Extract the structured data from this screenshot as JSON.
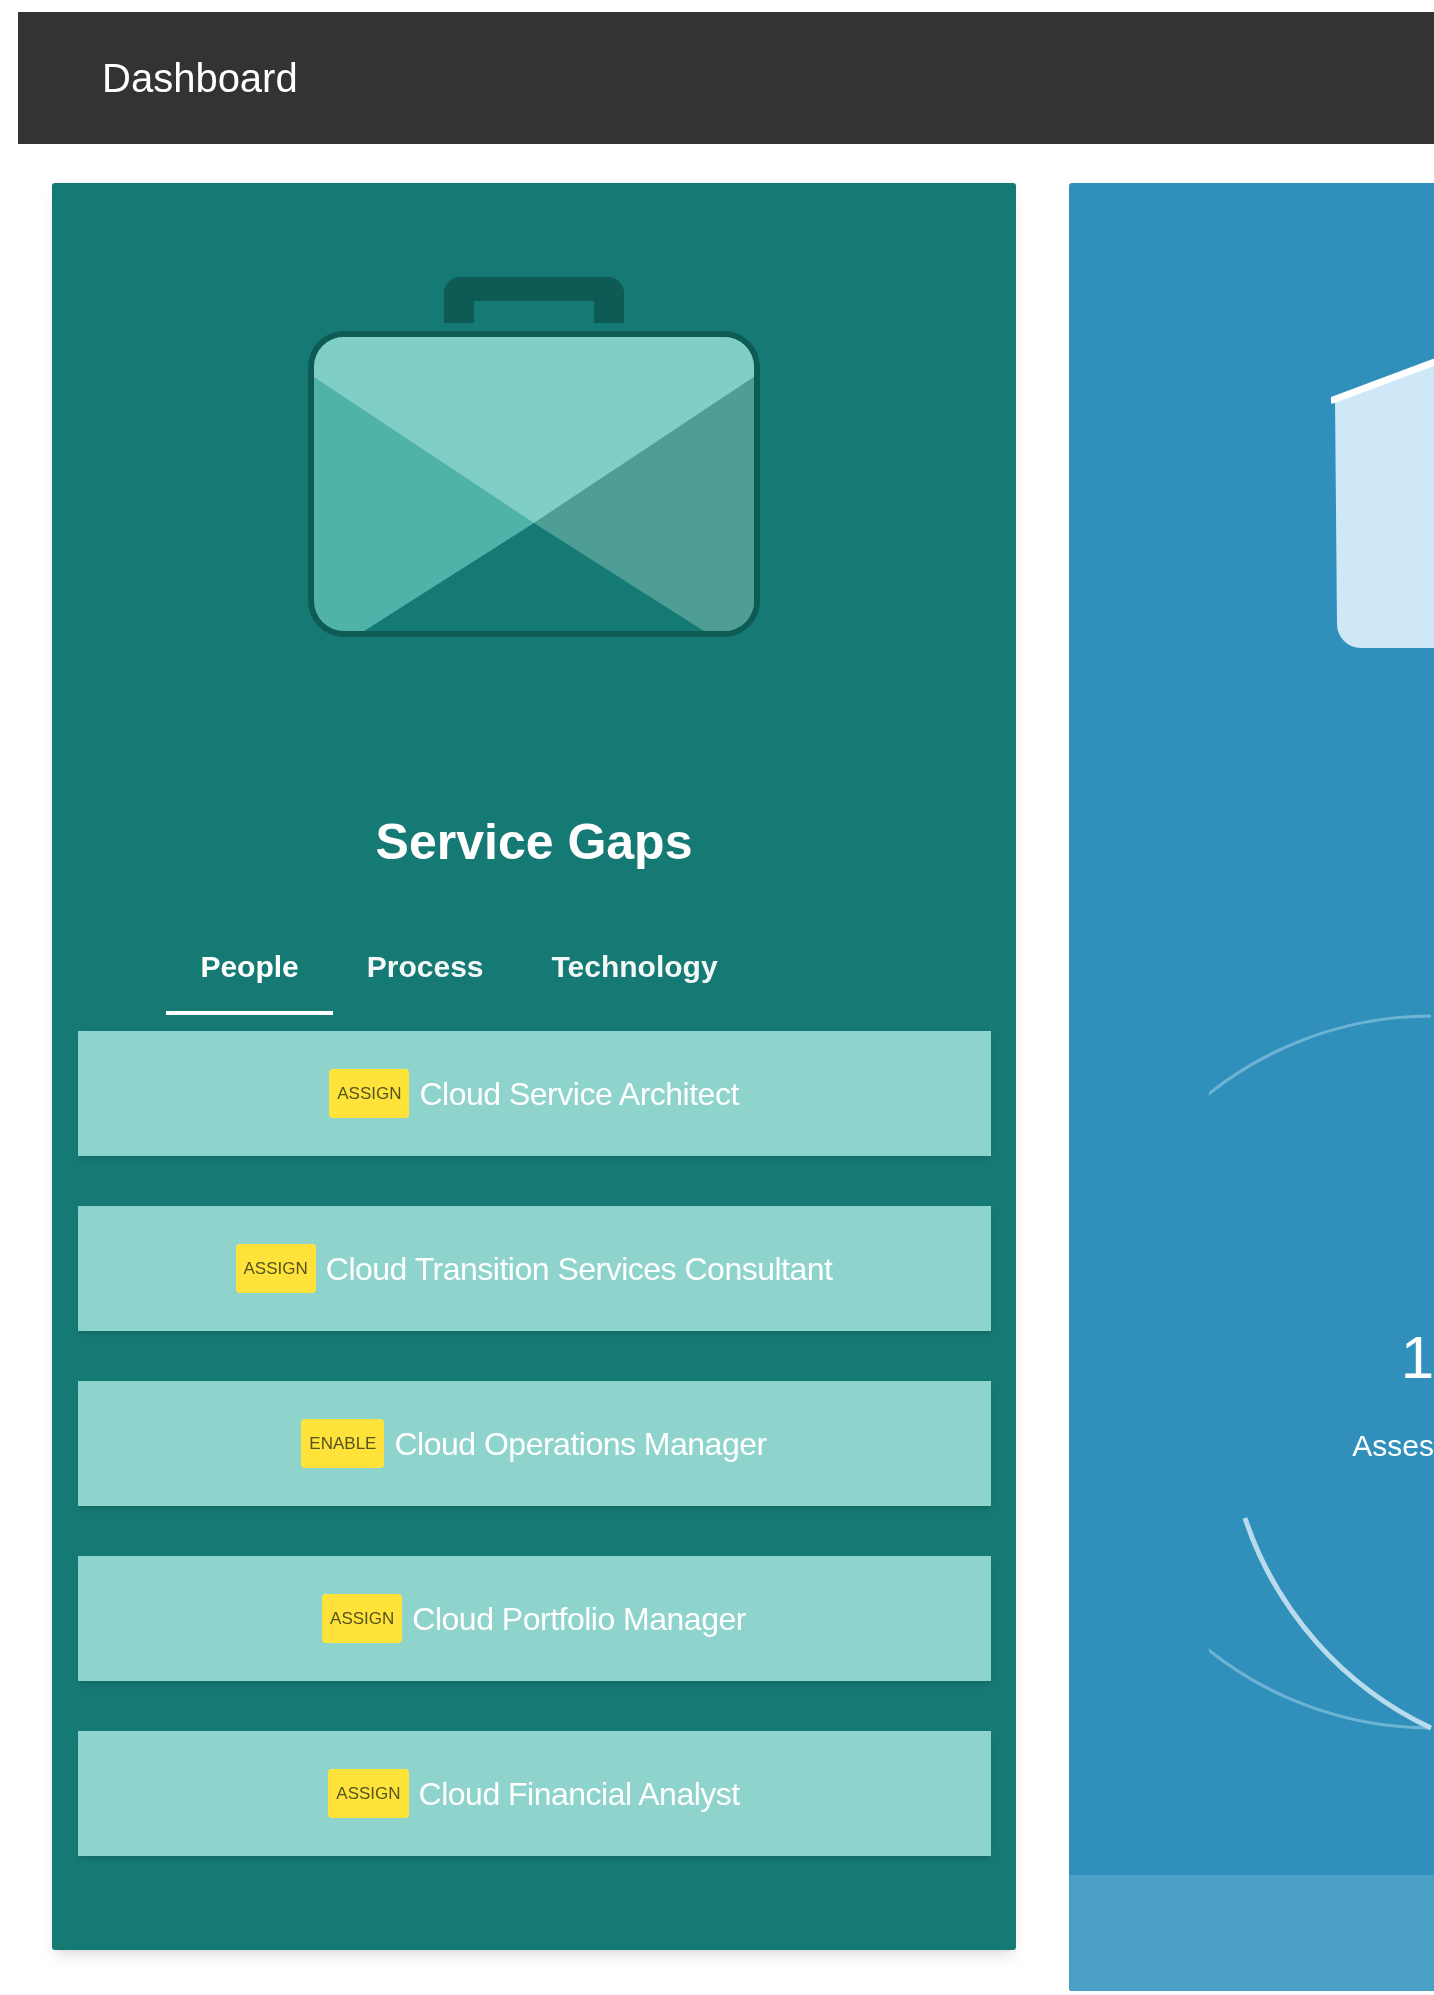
{
  "header": {
    "title": "Dashboard"
  },
  "service_gaps": {
    "title": "Service Gaps",
    "tabs": [
      {
        "label": "People",
        "selected": true
      },
      {
        "label": "Process",
        "selected": false
      },
      {
        "label": "Technology",
        "selected": false
      }
    ],
    "items": [
      {
        "badge": "ASSIGN",
        "label": "Cloud Service Architect"
      },
      {
        "badge": "ASSIGN",
        "label": "Cloud Transition Services Consultant"
      },
      {
        "badge": "ENABLE",
        "label": "Cloud Operations Manager"
      },
      {
        "badge": "ASSIGN",
        "label": "Cloud Portfolio Manager"
      },
      {
        "badge": "ASSIGN",
        "label": "Cloud Financial Analyst"
      }
    ]
  },
  "assessment_card": {
    "value": "1",
    "caption": "Asses"
  }
}
